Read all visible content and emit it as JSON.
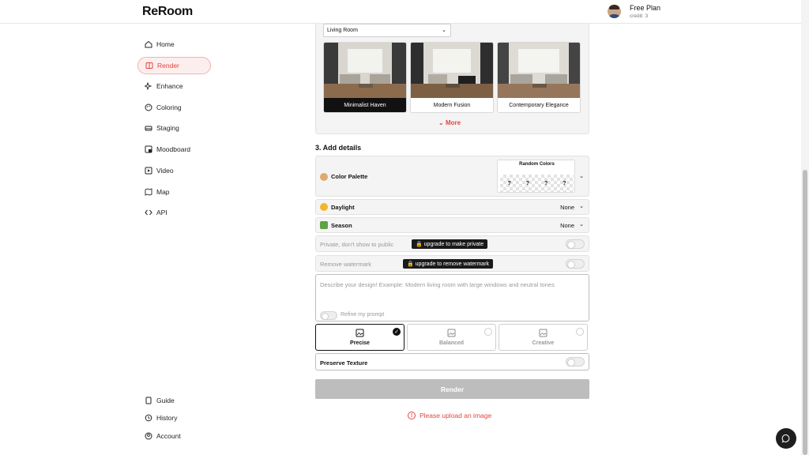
{
  "app": {
    "logo": "ReRoom"
  },
  "user": {
    "plan": "Free Plan",
    "credit": "credit: 3"
  },
  "sidebar": {
    "items": [
      {
        "label": "Home",
        "icon": "home-icon"
      },
      {
        "label": "Render",
        "icon": "render-icon",
        "active": true
      },
      {
        "label": "Enhance",
        "icon": "sparkle-icon"
      },
      {
        "label": "Coloring",
        "icon": "palette-icon"
      },
      {
        "label": "Staging",
        "icon": "sofa-icon"
      },
      {
        "label": "Moodboard",
        "icon": "moodboard-icon"
      },
      {
        "label": "Video",
        "icon": "video-icon"
      },
      {
        "label": "Map",
        "icon": "map-icon"
      },
      {
        "label": "API",
        "icon": "code-icon"
      }
    ],
    "bottom": [
      {
        "label": "Guide",
        "icon": "book-icon"
      },
      {
        "label": "History",
        "icon": "history-icon"
      },
      {
        "label": "Account",
        "icon": "account-icon"
      }
    ]
  },
  "style_section": {
    "room_select": "Living Room",
    "styles": [
      {
        "label": "Minimalist Haven",
        "selected": true
      },
      {
        "label": "Modern Fusion",
        "selected": false
      },
      {
        "label": "Contemporary Elegance",
        "selected": false
      }
    ],
    "more_label": "More"
  },
  "details": {
    "title": "3. Add details",
    "color_palette": {
      "label": "Color Palette",
      "box_title": "Random Colors",
      "swatches": [
        "?",
        "?",
        "?",
        "?"
      ]
    },
    "daylight": {
      "label": "Daylight",
      "value": "None"
    },
    "season": {
      "label": "Season",
      "value": "None"
    },
    "private": {
      "label": "Private, don't show to public",
      "badge": "🔒 upgrade to make private"
    },
    "watermark": {
      "label": "Remove watermark",
      "badge": "🔒 upgrade to remove watermark"
    },
    "prompt": {
      "placeholder": "Describe your design! Example: Modern living room with large windows and neutral tones",
      "refine_label": "Refine my prompt"
    },
    "modes": [
      {
        "label": "Precise",
        "selected": true
      },
      {
        "label": "Balanced",
        "selected": false
      },
      {
        "label": "Creative",
        "selected": false
      }
    ],
    "preserve_texture": {
      "label": "Preserve Texture"
    }
  },
  "actions": {
    "render_label": "Render",
    "error": "Please upload an image"
  },
  "colors": {
    "accent": "#e2453d",
    "dark": "#111111"
  }
}
